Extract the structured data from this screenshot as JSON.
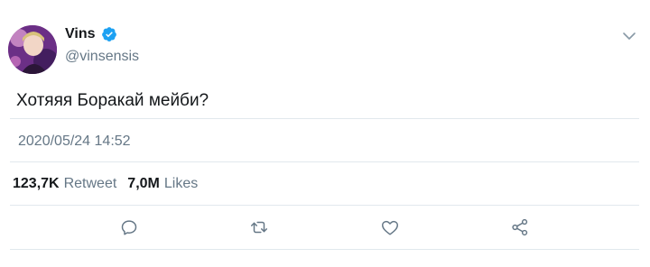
{
  "user": {
    "display_name": "Vins",
    "handle": "@vinsensis"
  },
  "tweet": {
    "text": "Хотяяя Боракай мейби?",
    "timestamp": "2020/05/24 14:52"
  },
  "stats": {
    "retweets_count": "123,7K",
    "retweets_label": "Retweet",
    "likes_count": "7,0M",
    "likes_label": "Likes"
  },
  "colors": {
    "verified": "#1da1f2",
    "muted": "#657786",
    "divider": "#e1e8ed"
  },
  "icons": {
    "menu": "chevron-down-icon",
    "verified": "verified-badge-icon",
    "reply": "reply-icon",
    "retweet": "retweet-icon",
    "like": "heart-icon",
    "share": "share-icon"
  }
}
